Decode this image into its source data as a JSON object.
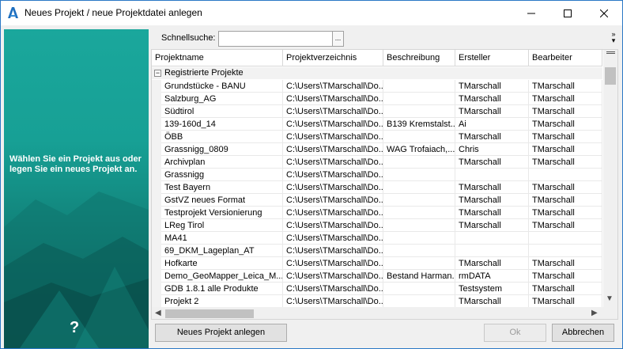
{
  "window": {
    "title": "Neues Projekt / neue Projektdatei anlegen"
  },
  "left_panel": {
    "message": "Wählen Sie ein Projekt aus oder legen Sie ein neues Projekt an.",
    "help_glyph": "?"
  },
  "search": {
    "label": "Schnellsuche:",
    "value": "",
    "button_label": "...",
    "overflow_glyph": "»"
  },
  "grid": {
    "columns": [
      "Projektname",
      "Projektverzeichnis",
      "Beschreibung",
      "Ersteller",
      "Bearbeiter"
    ],
    "group_toggle": "−",
    "group_label": "Registrierte Projekte",
    "rows": [
      [
        "Grundstücke - BANU",
        "C:\\Users\\TMarschall\\Do...",
        "",
        "TMarschall",
        "TMarschall"
      ],
      [
        "Salzburg_AG",
        "C:\\Users\\TMarschall\\Do...",
        "",
        "TMarschall",
        "TMarschall"
      ],
      [
        "Südtirol",
        "C:\\Users\\TMarschall\\Do...",
        "",
        "TMarschall",
        "TMarschall"
      ],
      [
        "139-160d_14",
        "C:\\Users\\TMarschall\\Do...",
        "B139 Kremstalst...",
        "Ai",
        "TMarschall"
      ],
      [
        "ÖBB",
        "C:\\Users\\TMarschall\\Do...",
        "",
        "TMarschall",
        "TMarschall"
      ],
      [
        "Grassnigg_0809",
        "C:\\Users\\TMarschall\\Do...",
        "WAG Trofaiach,...",
        "Chris",
        "TMarschall"
      ],
      [
        "Archivplan",
        "C:\\Users\\TMarschall\\Do...",
        "",
        "TMarschall",
        "TMarschall"
      ],
      [
        "Grassnigg",
        "C:\\Users\\TMarschall\\Do...",
        "",
        "",
        ""
      ],
      [
        "Test Bayern",
        "C:\\Users\\TMarschall\\Do...",
        "",
        "TMarschall",
        "TMarschall"
      ],
      [
        "GstVZ neues Format",
        "C:\\Users\\TMarschall\\Do...",
        "",
        "TMarschall",
        "TMarschall"
      ],
      [
        "Testprojekt Versionierung",
        "C:\\Users\\TMarschall\\Do...",
        "",
        "TMarschall",
        "TMarschall"
      ],
      [
        "LReg Tirol",
        "C:\\Users\\TMarschall\\Do...",
        "",
        "TMarschall",
        "TMarschall"
      ],
      [
        "MA41",
        "C:\\Users\\TMarschall\\Do...",
        "",
        "",
        ""
      ],
      [
        "69_DKM_Lageplan_AT",
        "C:\\Users\\TMarschall\\Do...",
        "",
        "",
        ""
      ],
      [
        "Hofkarte",
        "C:\\Users\\TMarschall\\Do...",
        "",
        "TMarschall",
        "TMarschall"
      ],
      [
        "Demo_GeoMapper_Leica_M...",
        "C:\\Users\\TMarschall\\Do...",
        "Bestand Harman...",
        "rmDATA",
        "TMarschall"
      ],
      [
        "GDB 1.8.1 alle Produkte",
        "C:\\Users\\TMarschall\\Do...",
        "",
        "Testsystem",
        "TMarschall"
      ],
      [
        "Projekt 2",
        "C:\\Users\\TMarschall\\Do...",
        "",
        "TMarschall",
        "TMarschall"
      ]
    ]
  },
  "buttons": {
    "new_project": "Neues Projekt anlegen",
    "ok": "Ok",
    "cancel": "Abbrechen"
  },
  "colors": {
    "accent": "#2b78c5",
    "panel_teal": "#17a095"
  }
}
